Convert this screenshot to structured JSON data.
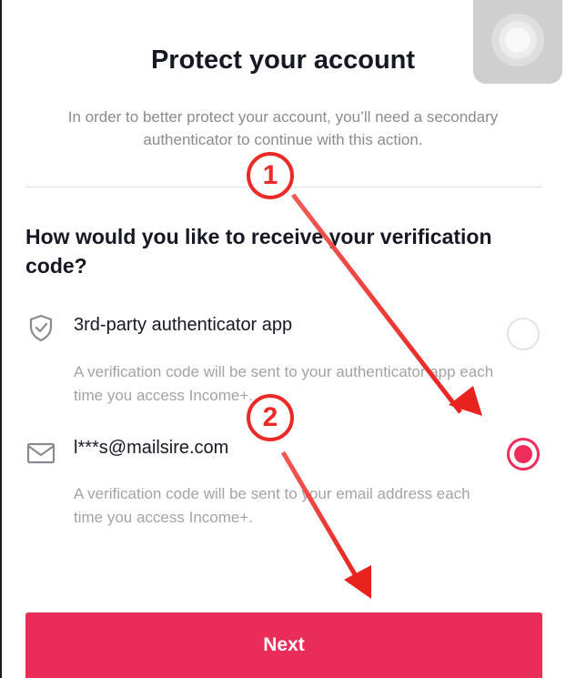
{
  "header": {
    "title": "Protect your account",
    "subtitle": "In order to better protect your account, you’ll need a secondary authenticator to continue with this action."
  },
  "question": "How would you like to receive your verification code?",
  "options": [
    {
      "icon": "shield-icon",
      "title": "3rd-party authenticator app",
      "description": "A verification code will be sent to your authenticator app each time you access Income+.",
      "selected": false
    },
    {
      "icon": "envelope-icon",
      "title": "l***s@mailsire.com",
      "description": "A verification code will be sent to your email address each time you access Income+.",
      "selected": true
    }
  ],
  "next_button": {
    "label": "Next"
  },
  "annotations": [
    {
      "label": "1"
    },
    {
      "label": "2"
    }
  ],
  "colors": {
    "accent": "#ea2c5a",
    "annotation": "#ea2a26",
    "text_primary": "#161823",
    "text_secondary": "#8a8b91"
  }
}
